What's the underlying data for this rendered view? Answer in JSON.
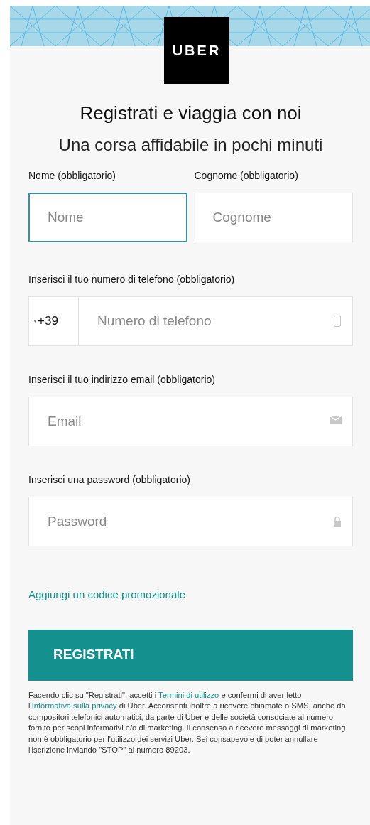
{
  "logo": {
    "text": "UBER"
  },
  "title": "Registrati e viaggia con noi",
  "subtitle": "Una corsa affidabile in pochi minuti",
  "name_fields": [
    {
      "label": "Nome (obbligatorio)",
      "placeholder": "Nome",
      "focused": true
    },
    {
      "label": "Cognome (obbligatorio)",
      "placeholder": "Cognome",
      "focused": false
    }
  ],
  "fields": [
    {
      "kind": "phone",
      "label": "Inserisci il tuo numero di telefono (obbligatorio)",
      "country_code": "+39",
      "placeholder": "Numero di telefono",
      "focused": false
    },
    {
      "kind": "email",
      "label": "Inserisci il tuo indirizzo email (obbligatorio)",
      "placeholder": "Email",
      "focused": false
    },
    {
      "kind": "password",
      "label": "Inserisci una password (obbligatorio)",
      "placeholder": "Password",
      "focused": false
    }
  ],
  "promo_link": "Aggiungi un codice promozionale",
  "submit_button": "REGISTRATI",
  "legal": [
    {
      "kind": "text",
      "text": "Facendo clic su \"Registrati\", accetti i "
    },
    {
      "kind": "link",
      "text": "Termini di utilizzo"
    },
    {
      "kind": "text",
      "text": " e confermi di aver letto l'"
    },
    {
      "kind": "link",
      "text": "Informativa sulla privacy"
    },
    {
      "kind": "text",
      "text": " di Uber. Acconsenti inoltre a ricevere chiamate o SMS, anche da compositori telefonici automatici, da parte di Uber e delle società consociate al numero fornito per scopi informativi e/o di marketing. Il consenso a ricevere messaggi di marketing non è obbligatorio per l'utilizzo dei servizi Uber. Sei consapevole di poter annullare l'iscrizione inviando \"STOP\" al numero 89203."
    }
  ]
}
